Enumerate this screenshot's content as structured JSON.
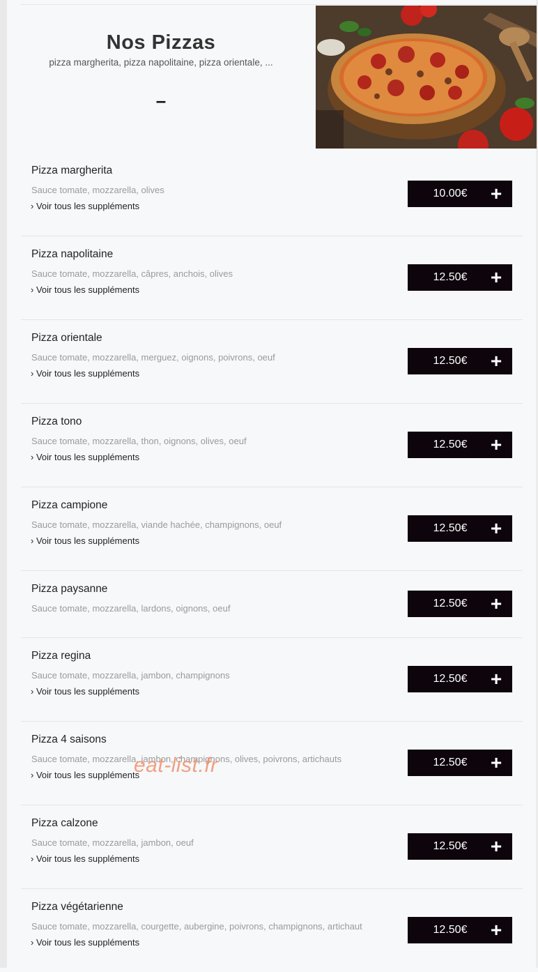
{
  "header": {
    "title": "Nos Pizzas",
    "subtitle": "pizza margherita, pizza napolitaine, pizza orientale, ...",
    "dash": "–"
  },
  "items": [
    {
      "name": "Pizza margherita",
      "desc": "Sauce tomate, mozzarella, olives",
      "link": "› Voir tous les suppléments",
      "price": "10.00€"
    },
    {
      "name": "Pizza napolitaine",
      "desc": "Sauce tomate, mozzarella, câpres, anchois, olives",
      "link": "› Voir tous les suppléments",
      "price": "12.50€"
    },
    {
      "name": "Pizza orientale",
      "desc": "Sauce tomate, mozzarella, merguez, oignons, poivrons, oeuf",
      "link": "› Voir tous les suppléments",
      "price": "12.50€"
    },
    {
      "name": "Pizza tono",
      "desc": "Sauce tomate, mozzarella, thon, oignons, olives, oeuf",
      "link": "› Voir tous les suppléments",
      "price": "12.50€"
    },
    {
      "name": "Pizza campione",
      "desc": "Sauce tomate, mozzarella, viande hachée, champignons, oeuf",
      "link": "› Voir tous les suppléments",
      "price": "12.50€"
    },
    {
      "name": "Pizza paysanne",
      "desc": "Sauce tomate, mozzarella, lardons, oignons, oeuf",
      "price": "12.50€"
    },
    {
      "name": "Pizza regina",
      "desc": "Sauce tomate, mozzarella, jambon, champignons",
      "link": "› Voir tous les suppléments",
      "price": "12.50€"
    },
    {
      "name": "Pizza 4 saisons",
      "desc": "Sauce tomate, mozzarella, jambon, champignons, olives, poivrons, artichauts",
      "link": "› Voir tous les suppléments",
      "price": "12.50€"
    },
    {
      "name": "Pizza calzone",
      "desc": "Sauce tomate, mozzarella, jambon, oeuf",
      "link": "› Voir tous les suppléments",
      "price": "12.50€"
    },
    {
      "name": "Pizza végétarienne",
      "desc": "Sauce tomate, mozzarella, courgette, aubergine, poivrons, champignons, artichaut",
      "link": "› Voir tous les suppléments",
      "price": "12.50€"
    }
  ],
  "buttons": {
    "add_icon": "+"
  },
  "watermark": "eat-list.fr",
  "colors": {
    "button_bg": "#0d040c",
    "desc_text": "#9a9a9a",
    "background": "#f7f8fa"
  }
}
